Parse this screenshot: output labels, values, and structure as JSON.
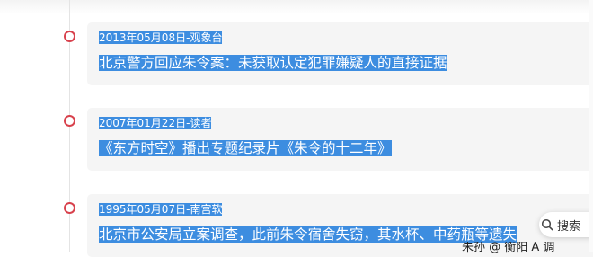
{
  "timeline": {
    "items": [
      {
        "date": "2013年05月08日",
        "sep": "-",
        "source": "观象台",
        "title": "北京警方回应朱令案：未获取认定犯罪嫌疑人的直接证据"
      },
      {
        "date": "2007年01月22日",
        "sep": "-",
        "source": "读者",
        "title": "《东方时空》播出专题纪录片《朱令的十二年》"
      },
      {
        "date": "1995年05月07日",
        "sep": "-",
        "source": "南宫软",
        "title": "北京市公安局立案调查，此前朱令宿舍失窃，其水杯、中药瓶等遗失"
      }
    ]
  },
  "floating": {
    "search_label": "搜索",
    "search_icon": "search-icon",
    "partial_text": "朱孙 @ 衡阳 A 调"
  },
  "colors": {
    "highlight": "#3d8de0",
    "dot": "#d8424d",
    "card": "#f5f5f5"
  }
}
